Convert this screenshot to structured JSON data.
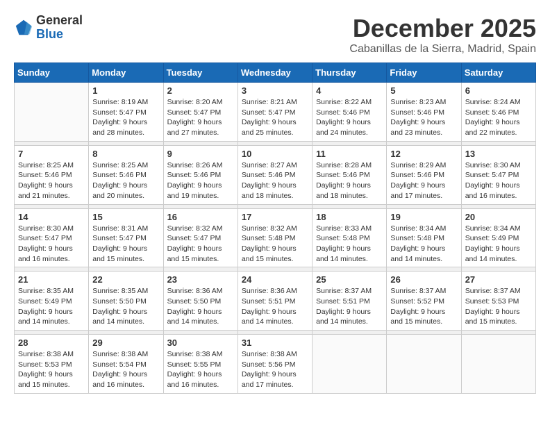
{
  "logo": {
    "general": "General",
    "blue": "Blue"
  },
  "header": {
    "month": "December 2025",
    "location": "Cabanillas de la Sierra, Madrid, Spain"
  },
  "days_of_week": [
    "Sunday",
    "Monday",
    "Tuesday",
    "Wednesday",
    "Thursday",
    "Friday",
    "Saturday"
  ],
  "weeks": [
    [
      {
        "day": "",
        "sunrise": "",
        "sunset": "",
        "daylight": ""
      },
      {
        "day": "1",
        "sunrise": "Sunrise: 8:19 AM",
        "sunset": "Sunset: 5:47 PM",
        "daylight": "Daylight: 9 hours and 28 minutes."
      },
      {
        "day": "2",
        "sunrise": "Sunrise: 8:20 AM",
        "sunset": "Sunset: 5:47 PM",
        "daylight": "Daylight: 9 hours and 27 minutes."
      },
      {
        "day": "3",
        "sunrise": "Sunrise: 8:21 AM",
        "sunset": "Sunset: 5:47 PM",
        "daylight": "Daylight: 9 hours and 25 minutes."
      },
      {
        "day": "4",
        "sunrise": "Sunrise: 8:22 AM",
        "sunset": "Sunset: 5:46 PM",
        "daylight": "Daylight: 9 hours and 24 minutes."
      },
      {
        "day": "5",
        "sunrise": "Sunrise: 8:23 AM",
        "sunset": "Sunset: 5:46 PM",
        "daylight": "Daylight: 9 hours and 23 minutes."
      },
      {
        "day": "6",
        "sunrise": "Sunrise: 8:24 AM",
        "sunset": "Sunset: 5:46 PM",
        "daylight": "Daylight: 9 hours and 22 minutes."
      }
    ],
    [
      {
        "day": "7",
        "sunrise": "Sunrise: 8:25 AM",
        "sunset": "Sunset: 5:46 PM",
        "daylight": "Daylight: 9 hours and 21 minutes."
      },
      {
        "day": "8",
        "sunrise": "Sunrise: 8:25 AM",
        "sunset": "Sunset: 5:46 PM",
        "daylight": "Daylight: 9 hours and 20 minutes."
      },
      {
        "day": "9",
        "sunrise": "Sunrise: 8:26 AM",
        "sunset": "Sunset: 5:46 PM",
        "daylight": "Daylight: 9 hours and 19 minutes."
      },
      {
        "day": "10",
        "sunrise": "Sunrise: 8:27 AM",
        "sunset": "Sunset: 5:46 PM",
        "daylight": "Daylight: 9 hours and 18 minutes."
      },
      {
        "day": "11",
        "sunrise": "Sunrise: 8:28 AM",
        "sunset": "Sunset: 5:46 PM",
        "daylight": "Daylight: 9 hours and 18 minutes."
      },
      {
        "day": "12",
        "sunrise": "Sunrise: 8:29 AM",
        "sunset": "Sunset: 5:46 PM",
        "daylight": "Daylight: 9 hours and 17 minutes."
      },
      {
        "day": "13",
        "sunrise": "Sunrise: 8:30 AM",
        "sunset": "Sunset: 5:47 PM",
        "daylight": "Daylight: 9 hours and 16 minutes."
      }
    ],
    [
      {
        "day": "14",
        "sunrise": "Sunrise: 8:30 AM",
        "sunset": "Sunset: 5:47 PM",
        "daylight": "Daylight: 9 hours and 16 minutes."
      },
      {
        "day": "15",
        "sunrise": "Sunrise: 8:31 AM",
        "sunset": "Sunset: 5:47 PM",
        "daylight": "Daylight: 9 hours and 15 minutes."
      },
      {
        "day": "16",
        "sunrise": "Sunrise: 8:32 AM",
        "sunset": "Sunset: 5:47 PM",
        "daylight": "Daylight: 9 hours and 15 minutes."
      },
      {
        "day": "17",
        "sunrise": "Sunrise: 8:32 AM",
        "sunset": "Sunset: 5:48 PM",
        "daylight": "Daylight: 9 hours and 15 minutes."
      },
      {
        "day": "18",
        "sunrise": "Sunrise: 8:33 AM",
        "sunset": "Sunset: 5:48 PM",
        "daylight": "Daylight: 9 hours and 14 minutes."
      },
      {
        "day": "19",
        "sunrise": "Sunrise: 8:34 AM",
        "sunset": "Sunset: 5:48 PM",
        "daylight": "Daylight: 9 hours and 14 minutes."
      },
      {
        "day": "20",
        "sunrise": "Sunrise: 8:34 AM",
        "sunset": "Sunset: 5:49 PM",
        "daylight": "Daylight: 9 hours and 14 minutes."
      }
    ],
    [
      {
        "day": "21",
        "sunrise": "Sunrise: 8:35 AM",
        "sunset": "Sunset: 5:49 PM",
        "daylight": "Daylight: 9 hours and 14 minutes."
      },
      {
        "day": "22",
        "sunrise": "Sunrise: 8:35 AM",
        "sunset": "Sunset: 5:50 PM",
        "daylight": "Daylight: 9 hours and 14 minutes."
      },
      {
        "day": "23",
        "sunrise": "Sunrise: 8:36 AM",
        "sunset": "Sunset: 5:50 PM",
        "daylight": "Daylight: 9 hours and 14 minutes."
      },
      {
        "day": "24",
        "sunrise": "Sunrise: 8:36 AM",
        "sunset": "Sunset: 5:51 PM",
        "daylight": "Daylight: 9 hours and 14 minutes."
      },
      {
        "day": "25",
        "sunrise": "Sunrise: 8:37 AM",
        "sunset": "Sunset: 5:51 PM",
        "daylight": "Daylight: 9 hours and 14 minutes."
      },
      {
        "day": "26",
        "sunrise": "Sunrise: 8:37 AM",
        "sunset": "Sunset: 5:52 PM",
        "daylight": "Daylight: 9 hours and 15 minutes."
      },
      {
        "day": "27",
        "sunrise": "Sunrise: 8:37 AM",
        "sunset": "Sunset: 5:53 PM",
        "daylight": "Daylight: 9 hours and 15 minutes."
      }
    ],
    [
      {
        "day": "28",
        "sunrise": "Sunrise: 8:38 AM",
        "sunset": "Sunset: 5:53 PM",
        "daylight": "Daylight: 9 hours and 15 minutes."
      },
      {
        "day": "29",
        "sunrise": "Sunrise: 8:38 AM",
        "sunset": "Sunset: 5:54 PM",
        "daylight": "Daylight: 9 hours and 16 minutes."
      },
      {
        "day": "30",
        "sunrise": "Sunrise: 8:38 AM",
        "sunset": "Sunset: 5:55 PM",
        "daylight": "Daylight: 9 hours and 16 minutes."
      },
      {
        "day": "31",
        "sunrise": "Sunrise: 8:38 AM",
        "sunset": "Sunset: 5:56 PM",
        "daylight": "Daylight: 9 hours and 17 minutes."
      },
      {
        "day": "",
        "sunrise": "",
        "sunset": "",
        "daylight": ""
      },
      {
        "day": "",
        "sunrise": "",
        "sunset": "",
        "daylight": ""
      },
      {
        "day": "",
        "sunrise": "",
        "sunset": "",
        "daylight": ""
      }
    ]
  ]
}
